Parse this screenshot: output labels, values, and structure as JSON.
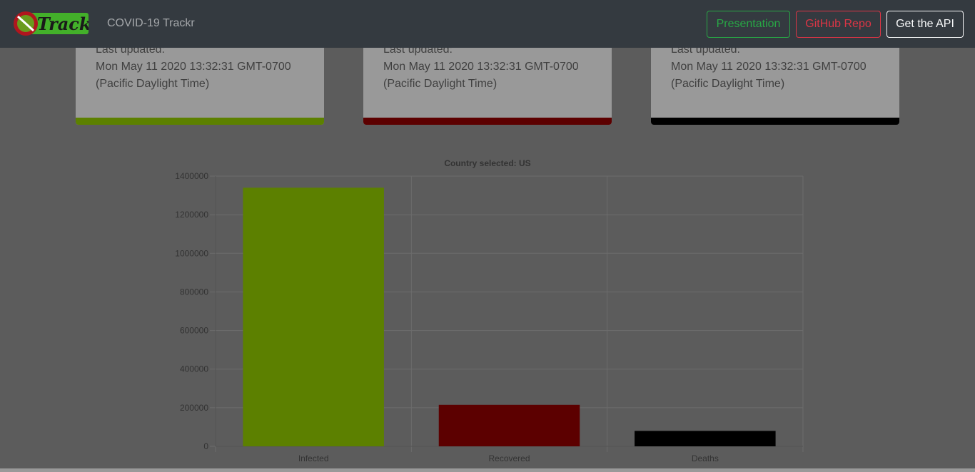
{
  "navbar": {
    "logo_text": "Trackr",
    "brand": "COVID-19 Trackr",
    "buttons": {
      "presentation": "Presentation",
      "github": "GitHub Repo",
      "api": "Get the API"
    }
  },
  "cards": [
    {
      "last_updated_label": "Last updated:",
      "timestamp": "Mon May 11 2020 13:32:31 GMT-0700",
      "timezone": "(Pacific Daylight Time)",
      "color": "#99d600"
    },
    {
      "last_updated_label": "Last updated:",
      "timestamp": "Mon May 11 2020 13:32:31 GMT-0700",
      "timezone": "(Pacific Daylight Time)",
      "color": "#990000"
    },
    {
      "last_updated_label": "Last updated:",
      "timestamp": "Mon May 11 2020 13:32:31 GMT-0700",
      "timezone": "(Pacific Daylight Time)",
      "color": "#000000"
    }
  ],
  "chart_data": {
    "type": "bar",
    "title": "Country selected: US",
    "categories": [
      "Infected",
      "Recovered",
      "Deaths"
    ],
    "values": [
      1340000,
      215000,
      80000
    ],
    "colors": [
      "#99d600",
      "#990000",
      "#000000"
    ],
    "ylim": [
      0,
      1400000
    ],
    "yticks": [
      "0",
      "200000",
      "400000",
      "600000",
      "800000",
      "1000000",
      "1200000",
      "1400000"
    ],
    "grid": true,
    "legend": "none"
  }
}
